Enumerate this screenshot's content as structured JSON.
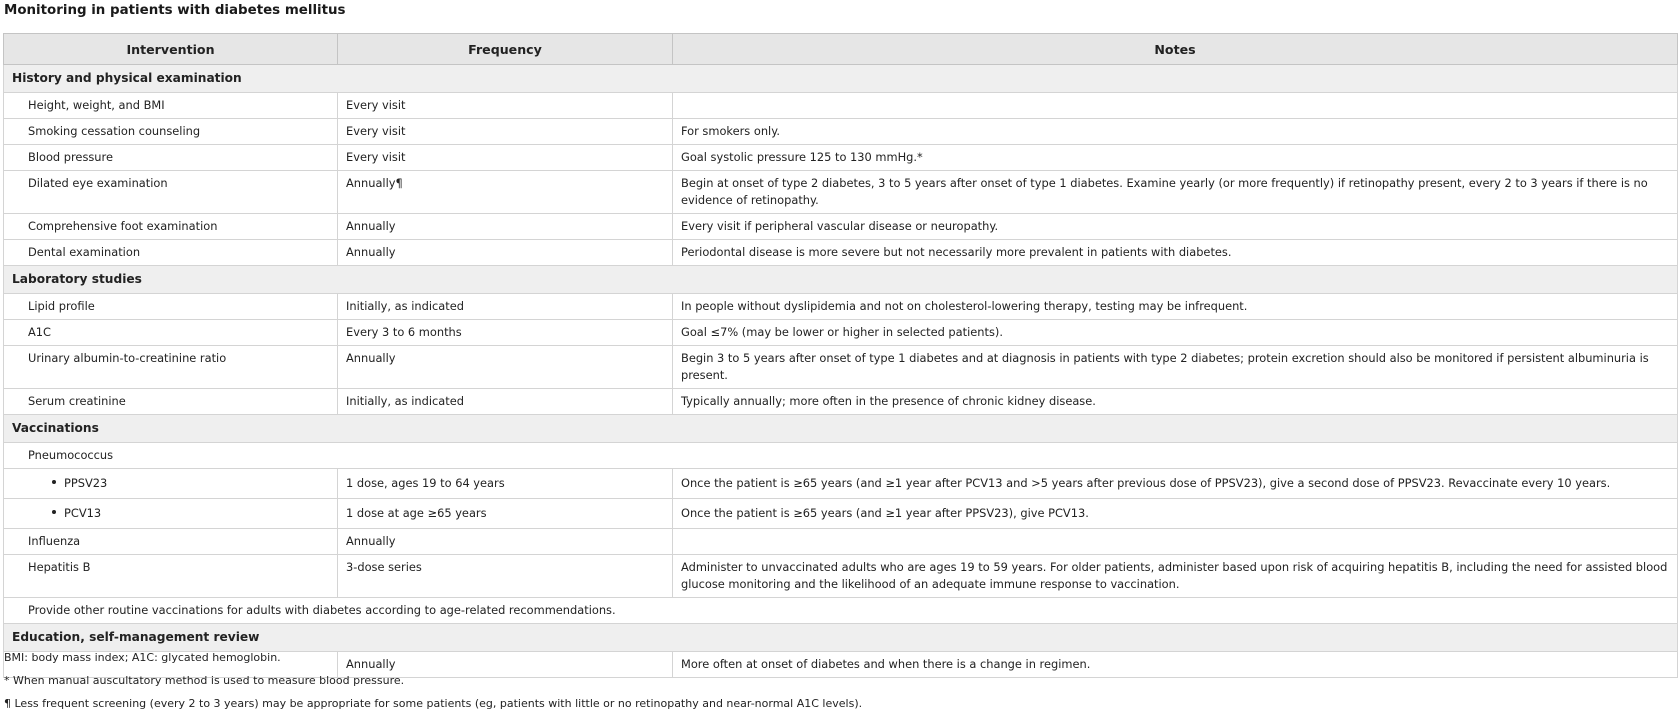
{
  "title": "Monitoring in patients with diabetes mellitus",
  "headers": {
    "intervention": "Intervention",
    "frequency": "Frequency",
    "notes": "Notes"
  },
  "sections": {
    "history": {
      "label": "History and physical examination",
      "rows": [
        {
          "intervention": "Height, weight, and BMI",
          "frequency": "Every visit",
          "notes": ""
        },
        {
          "intervention": "Smoking cessation counseling",
          "frequency": "Every visit",
          "notes": "For smokers only."
        },
        {
          "intervention": "Blood pressure",
          "frequency": "Every visit",
          "notes": "Goal systolic pressure 125 to 130 mmHg.*"
        },
        {
          "intervention": "Dilated eye examination",
          "frequency": "Annually¶",
          "notes": "Begin at onset of type 2 diabetes, 3 to 5 years after onset of type 1 diabetes. Examine yearly (or more frequently) if retinopathy present, every 2 to 3 years if there is no evidence of retinopathy."
        },
        {
          "intervention": "Comprehensive foot examination",
          "frequency": "Annually",
          "notes": "Every visit if peripheral vascular disease or neuropathy."
        },
        {
          "intervention": "Dental examination",
          "frequency": "Annually",
          "notes": "Periodontal disease is more severe but not necessarily more prevalent in patients with diabetes."
        }
      ]
    },
    "lab": {
      "label": "Laboratory studies",
      "rows": [
        {
          "intervention": "Lipid profile",
          "frequency": "Initially, as indicated",
          "notes": "In people without dyslipidemia and not on cholesterol-lowering therapy, testing may be infrequent."
        },
        {
          "intervention": "A1C",
          "frequency": "Every 3 to 6 months",
          "notes": "Goal ≤7% (may be lower or higher in selected patients)."
        },
        {
          "intervention": "Urinary albumin-to-creatinine ratio",
          "frequency": "Annually",
          "notes": "Begin 3 to 5 years after onset of type 1 diabetes and at diagnosis in patients with type 2 diabetes; protein excretion should also be monitored if persistent albuminuria is present."
        },
        {
          "intervention": "Serum creatinine",
          "frequency": "Initially, as indicated",
          "notes": "Typically annually; more often in the presence of chronic kidney disease."
        }
      ]
    },
    "vacc": {
      "label": "Vaccinations",
      "pneumococcus": "Pneumococcus",
      "ppsv23": {
        "intervention": "PPSV23",
        "frequency": "1 dose, ages 19 to 64 years",
        "notes": "Once the patient is ≥65 years (and ≥1 year after PCV13 and >5 years after previous dose of PPSV23), give a second dose of PPSV23. Revaccinate every 10 years."
      },
      "pcv13": {
        "intervention": "PCV13",
        "frequency": "1 dose at age ≥65 years",
        "notes": "Once the patient is ≥65 years (and ≥1 year after PPSV23), give PCV13."
      },
      "influenza": {
        "intervention": "Influenza",
        "frequency": "Annually",
        "notes": ""
      },
      "hepb": {
        "intervention": "Hepatitis B",
        "frequency": "3-dose series",
        "notes": "Administer to unvaccinated adults who are ages 19 to 59 years. For older patients, administer based upon risk of acquiring hepatitis B, including the need for assisted blood glucose monitoring and the likelihood of an adequate immune response to vaccination."
      },
      "other": "Provide other routine vaccinations for adults with diabetes according to age-related recommendations."
    },
    "edu": {
      "label": "Education, self-management review",
      "row": {
        "intervention": "",
        "frequency": "Annually",
        "notes": "More often at onset of diabetes and when there is a change in regimen."
      }
    }
  },
  "footnotes": [
    "BMI: body mass index; A1C: glycated hemoglobin.",
    "* When manual auscultatory method is used to measure blood pressure.",
    "¶ Less frequent screening (every 2 to 3 years) may be appropriate for some patients (eg, patients with little or no retinopathy and near-normal A1C levels)."
  ]
}
